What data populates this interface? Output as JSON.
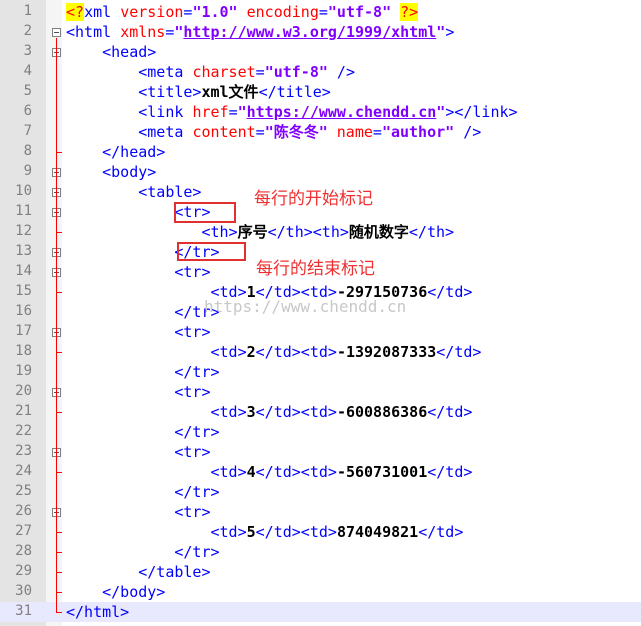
{
  "editor": {
    "lines": [
      {
        "n": "1",
        "tokens": [
          {
            "c": "pi",
            "t": "<?"
          },
          {
            "c": "t",
            "t": "xml "
          },
          {
            "c": "a",
            "t": "version"
          },
          {
            "c": "t",
            "t": "="
          },
          {
            "c": "v",
            "t": "\"1.0\""
          },
          {
            "c": "t",
            "t": " "
          },
          {
            "c": "a",
            "t": "encoding"
          },
          {
            "c": "t",
            "t": "="
          },
          {
            "c": "v",
            "t": "\"utf-8\""
          },
          {
            "c": "t",
            "t": " "
          },
          {
            "c": "pi",
            "t": "?>"
          }
        ]
      },
      {
        "n": "2",
        "tokens": [
          {
            "c": "t",
            "t": "<html "
          },
          {
            "c": "a",
            "t": "xmlns"
          },
          {
            "c": "t",
            "t": "="
          },
          {
            "c": "v",
            "t": "\""
          },
          {
            "c": "u",
            "t": "http://www.w3.org/1999/xhtml"
          },
          {
            "c": "v",
            "t": "\""
          },
          {
            "c": "t",
            "t": ">"
          }
        ]
      },
      {
        "n": "3",
        "tokens": [
          {
            "c": "t",
            "t": "    <head>"
          }
        ]
      },
      {
        "n": "4",
        "tokens": [
          {
            "c": "t",
            "t": "        <meta "
          },
          {
            "c": "a",
            "t": "charset"
          },
          {
            "c": "t",
            "t": "="
          },
          {
            "c": "v",
            "t": "\"utf-8\""
          },
          {
            "c": "t",
            "t": " />"
          }
        ]
      },
      {
        "n": "5",
        "tokens": [
          {
            "c": "t",
            "t": "        <title>"
          },
          {
            "c": "x",
            "t": "xml文件"
          },
          {
            "c": "t",
            "t": "</title>"
          }
        ]
      },
      {
        "n": "6",
        "tokens": [
          {
            "c": "t",
            "t": "        <link "
          },
          {
            "c": "a",
            "t": "href"
          },
          {
            "c": "t",
            "t": "="
          },
          {
            "c": "v",
            "t": "\""
          },
          {
            "c": "u",
            "t": "https://www.chendd.cn"
          },
          {
            "c": "v",
            "t": "\""
          },
          {
            "c": "t",
            "t": "></link>"
          }
        ]
      },
      {
        "n": "7",
        "tokens": [
          {
            "c": "t",
            "t": "        <meta "
          },
          {
            "c": "a",
            "t": "content"
          },
          {
            "c": "t",
            "t": "="
          },
          {
            "c": "v",
            "t": "\"陈冬冬\""
          },
          {
            "c": "t",
            "t": " "
          },
          {
            "c": "a",
            "t": "name"
          },
          {
            "c": "t",
            "t": "="
          },
          {
            "c": "v",
            "t": "\"author\""
          },
          {
            "c": "t",
            "t": " />"
          }
        ]
      },
      {
        "n": "8",
        "tokens": [
          {
            "c": "t",
            "t": "    </head>"
          }
        ]
      },
      {
        "n": "9",
        "tokens": [
          {
            "c": "t",
            "t": "    <body>"
          }
        ]
      },
      {
        "n": "10",
        "tokens": [
          {
            "c": "t",
            "t": "        <table>"
          }
        ]
      },
      {
        "n": "11",
        "tokens": [
          {
            "c": "t",
            "t": "            <tr>"
          }
        ]
      },
      {
        "n": "12",
        "tokens": [
          {
            "c": "t",
            "t": "               <th>"
          },
          {
            "c": "x",
            "t": "序号"
          },
          {
            "c": "t",
            "t": "</th><th>"
          },
          {
            "c": "x",
            "t": "随机数字"
          },
          {
            "c": "t",
            "t": "</th>"
          }
        ]
      },
      {
        "n": "13",
        "tokens": [
          {
            "c": "t",
            "t": "            </tr>"
          }
        ]
      },
      {
        "n": "14",
        "tokens": [
          {
            "c": "t",
            "t": "            <tr>"
          }
        ]
      },
      {
        "n": "15",
        "tokens": [
          {
            "c": "t",
            "t": "                <td>"
          },
          {
            "c": "x",
            "t": "1"
          },
          {
            "c": "t",
            "t": "</td><td>"
          },
          {
            "c": "x",
            "t": "-297150736"
          },
          {
            "c": "t",
            "t": "</td>"
          }
        ]
      },
      {
        "n": "16",
        "tokens": [
          {
            "c": "t",
            "t": "            </tr>"
          }
        ]
      },
      {
        "n": "17",
        "tokens": [
          {
            "c": "t",
            "t": "            <tr>"
          }
        ]
      },
      {
        "n": "18",
        "tokens": [
          {
            "c": "t",
            "t": "                <td>"
          },
          {
            "c": "x",
            "t": "2"
          },
          {
            "c": "t",
            "t": "</td><td>"
          },
          {
            "c": "x",
            "t": "-1392087333"
          },
          {
            "c": "t",
            "t": "</td>"
          }
        ]
      },
      {
        "n": "19",
        "tokens": [
          {
            "c": "t",
            "t": "            </tr>"
          }
        ]
      },
      {
        "n": "20",
        "tokens": [
          {
            "c": "t",
            "t": "            <tr>"
          }
        ]
      },
      {
        "n": "21",
        "tokens": [
          {
            "c": "t",
            "t": "                <td>"
          },
          {
            "c": "x",
            "t": "3"
          },
          {
            "c": "t",
            "t": "</td><td>"
          },
          {
            "c": "x",
            "t": "-600886386"
          },
          {
            "c": "t",
            "t": "</td>"
          }
        ]
      },
      {
        "n": "22",
        "tokens": [
          {
            "c": "t",
            "t": "            </tr>"
          }
        ]
      },
      {
        "n": "23",
        "tokens": [
          {
            "c": "t",
            "t": "            <tr>"
          }
        ]
      },
      {
        "n": "24",
        "tokens": [
          {
            "c": "t",
            "t": "                <td>"
          },
          {
            "c": "x",
            "t": "4"
          },
          {
            "c": "t",
            "t": "</td><td>"
          },
          {
            "c": "x",
            "t": "-560731001"
          },
          {
            "c": "t",
            "t": "</td>"
          }
        ]
      },
      {
        "n": "25",
        "tokens": [
          {
            "c": "t",
            "t": "            </tr>"
          }
        ]
      },
      {
        "n": "26",
        "tokens": [
          {
            "c": "t",
            "t": "            <tr>"
          }
        ]
      },
      {
        "n": "27",
        "tokens": [
          {
            "c": "t",
            "t": "                <td>"
          },
          {
            "c": "x",
            "t": "5"
          },
          {
            "c": "t",
            "t": "</td><td>"
          },
          {
            "c": "x",
            "t": "874049821"
          },
          {
            "c": "t",
            "t": "</td>"
          }
        ]
      },
      {
        "n": "28",
        "tokens": [
          {
            "c": "t",
            "t": "            </tr>"
          }
        ]
      },
      {
        "n": "29",
        "tokens": [
          {
            "c": "t",
            "t": "        </table>"
          }
        ]
      },
      {
        "n": "30",
        "tokens": [
          {
            "c": "t",
            "t": "    </body>"
          }
        ]
      },
      {
        "n": "31",
        "tokens": [
          {
            "c": "t",
            "t": "</html>"
          }
        ]
      }
    ],
    "current_line": "31"
  },
  "annotations": {
    "row_start": "每行的开始标记",
    "row_end": "每行的结束标记"
  },
  "watermark": "https://www.chendd.cn",
  "colors": {
    "tag": "#0000ff",
    "attribute": "#ff0000",
    "value": "#8000ff",
    "text": "#000000",
    "annotation": "#ee3030"
  }
}
